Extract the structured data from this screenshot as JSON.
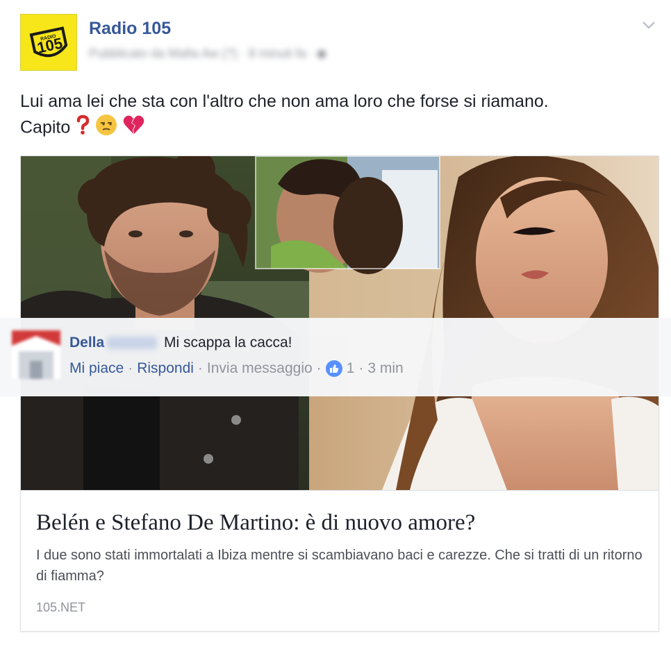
{
  "header": {
    "page_name": "Radio 105",
    "meta_line": "Pubblicato da Mafia Aw (?) · 8 minuti fa · ",
    "logo_text": "105",
    "logo_top_text": "RADIO"
  },
  "post": {
    "message_line1": "Lui ama lei che sta con l'altro che non ama loro che forse si riamano.",
    "message_line2": "Capito"
  },
  "link_preview": {
    "title": "Belén e Stefano De Martino: è di nuovo amore?",
    "description": "I due sono stati immortalati a Ibiza mentre si scambiavano baci e carezze. Che si tratti di un ritorno di fiamma?",
    "domain": "105.NET"
  },
  "comment": {
    "author": "Della",
    "text": "Mi scappa la cacca!",
    "action_like": "Mi piace",
    "action_reply": "Rispondi",
    "action_message": "Invia messaggio",
    "separator": "·",
    "like_count": "1",
    "time": "3 min"
  },
  "colors": {
    "link_blue": "#365899",
    "meta_gray": "#90949c",
    "like_blue": "#5890ff",
    "logo_yellow": "#f6e61a"
  },
  "icons": [
    "radio-105-logo",
    "chevron-down-icon",
    "question-mark-icon",
    "unamused-face-icon",
    "broken-heart-icon",
    "like-thumb-icon"
  ]
}
